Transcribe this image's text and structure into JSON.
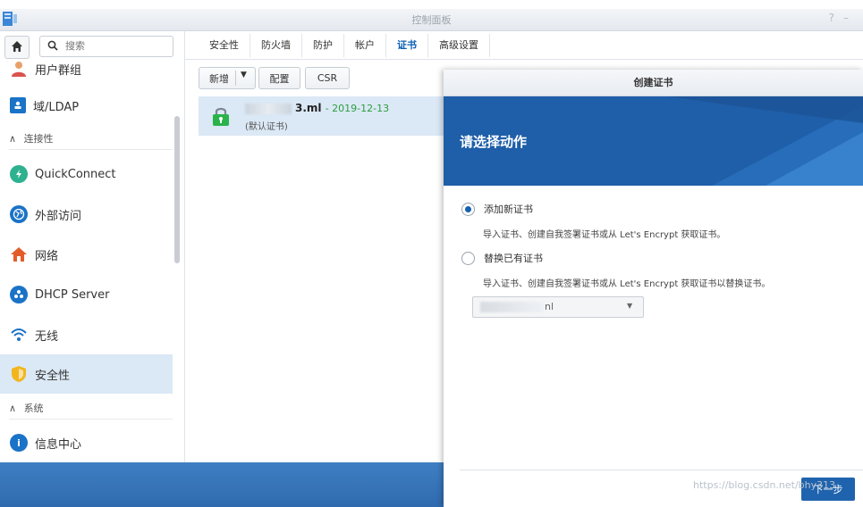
{
  "window": {
    "title": "控制面板"
  },
  "search": {
    "placeholder": "搜索"
  },
  "sidebar": {
    "items": [
      {
        "label": "用户群组"
      },
      {
        "label": "域/LDAP"
      },
      {
        "label": "QuickConnect"
      },
      {
        "label": "外部访问"
      },
      {
        "label": "网络"
      },
      {
        "label": "DHCP Server"
      },
      {
        "label": "无线"
      },
      {
        "label": "安全性"
      },
      {
        "label": "信息中心"
      }
    ],
    "categories": {
      "connectivity": "连接性",
      "system": "系统"
    }
  },
  "tabs": [
    "安全性",
    "防火墙",
    "防护",
    "帐户",
    "证书",
    "高级设置"
  ],
  "toolbar": {
    "add_label": "新增",
    "config_label": "配置",
    "csr_label": "CSR"
  },
  "certificate": {
    "name": "3.ml",
    "date": "- 2019-12-13",
    "default_label": "(默认证书)"
  },
  "dialog": {
    "title": "创建证书",
    "heading": "请选择动作",
    "option1_label": "添加新证书",
    "option1_desc": "导入证书、创建自我签署证书或从 Let's Encrypt 获取证书。",
    "option2_label": "替换已有证书",
    "option2_desc": "导入证书、创建自我签署证书或从 Let's Encrypt 获取证书以替换证书。",
    "selected_cert": "nl",
    "next_label": "下一步"
  },
  "watermark": "https://blog.csdn.net/bhy313",
  "colors": {
    "accent": "#1f5ea8",
    "active_tab": "#0a5fb4",
    "selection": "#dbe8f5",
    "date_green": "#2e9d3e"
  }
}
